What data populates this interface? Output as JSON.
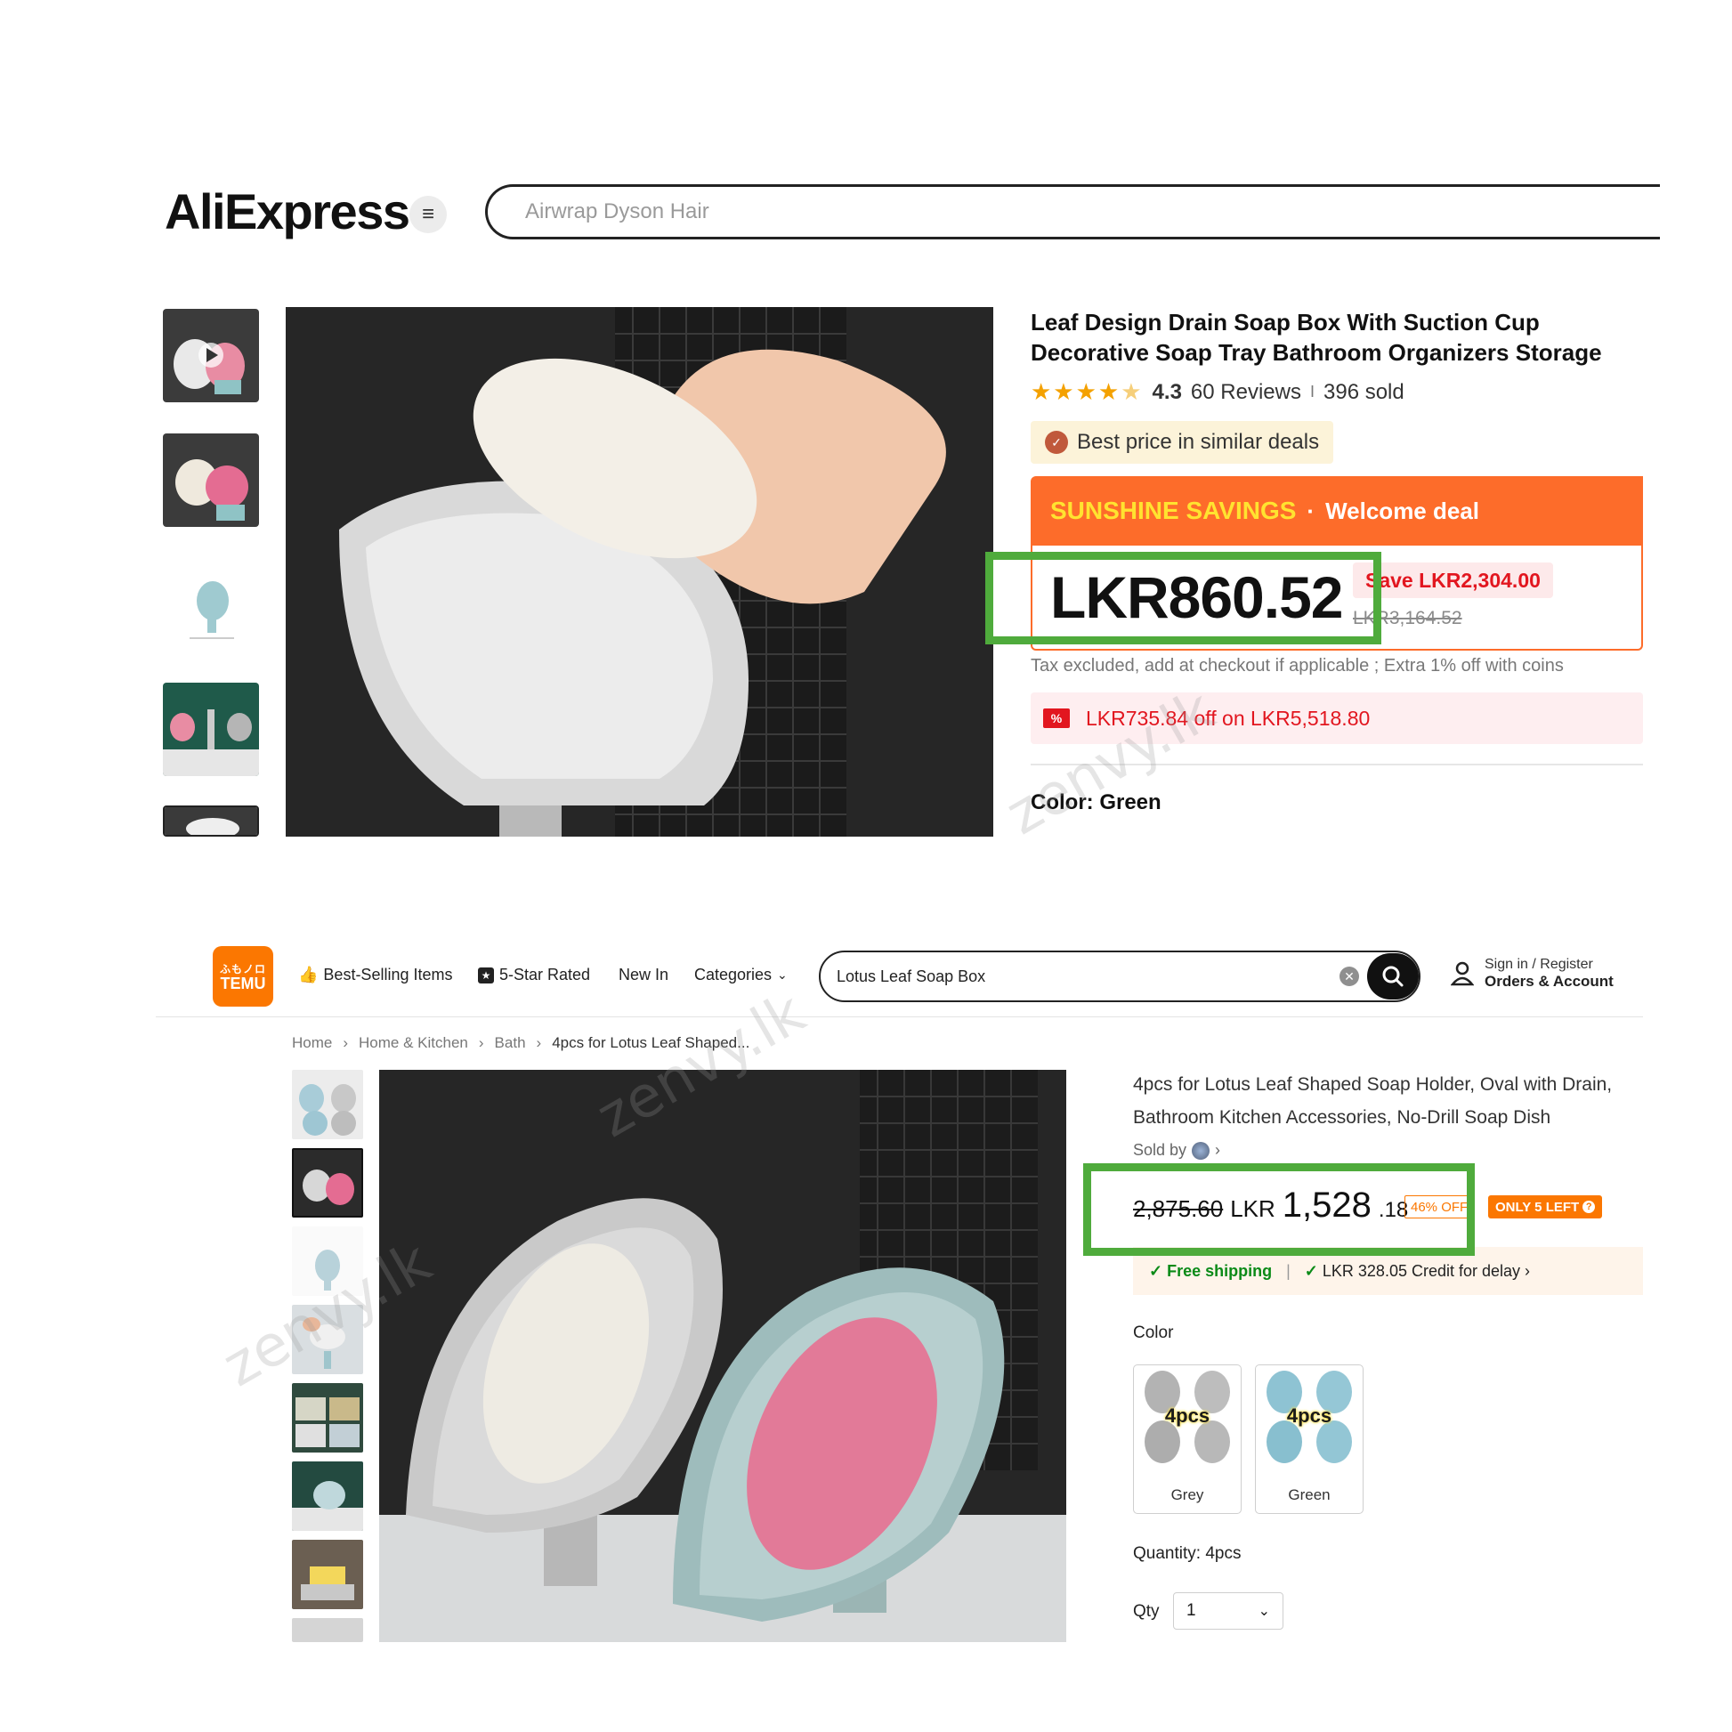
{
  "aliexpress": {
    "logo": "AliExpress",
    "search": {
      "placeholder": "Airwrap Dyson Hair"
    },
    "thumbnails": [
      "product thumbnail 1 (video)",
      "product thumbnail 2",
      "product thumbnail 3",
      "product thumbnail 4",
      "product thumbnail 5"
    ],
    "title": "Leaf Design Drain Soap Box With Suction Cup Decorative Soap Tray Bathroom Organizers Storage",
    "rating": {
      "value": "4.3",
      "stars": 4.3,
      "reviews": "60 Reviews",
      "separator": "I",
      "sold": "396 sold"
    },
    "best_price": "Best price in similar deals",
    "banner": {
      "event": "SUNSHINE SAVINGS",
      "dot": "·",
      "deal": "Welcome deal"
    },
    "price": "LKR860.52",
    "save": "Save LKR2,304.00",
    "original_price": "LKR3,164.52",
    "tax_note": "Tax excluded, add at checkout if applicable ; Extra 1% off with coins",
    "coupon": {
      "icon": "%",
      "text": "LKR735.84 off on LKR5,518.80"
    },
    "color": "Color: Green"
  },
  "temu": {
    "logo": {
      "line1": "ふもノロ",
      "line2": "TEMU"
    },
    "nav": [
      {
        "label": "Best-Selling Items",
        "icon": "thumbs-up-icon"
      },
      {
        "label": "5-Star Rated",
        "icon": "star-badge-icon"
      },
      {
        "label": "New In"
      },
      {
        "label": "Categories",
        "icon": "chevron-down-icon"
      }
    ],
    "search": {
      "value": "Lotus Leaf Soap Box"
    },
    "account": {
      "sign_in": "Sign in / Register",
      "orders": "Orders & Account"
    },
    "breadcrumb": [
      "Home",
      "Home & Kitchen",
      "Bath",
      "4pcs for Lotus Leaf Shaped..."
    ],
    "title": "4pcs for Lotus Leaf Shaped Soap Holder, Oval with Drain, Bathroom Kitchen Accessories, No-Drill Soap Dish",
    "sold_by": "Sold by",
    "price": {
      "original": "2,875.60",
      "currency": "LKR",
      "integer": "1,528",
      "decimal": ".18"
    },
    "discount": "46% OFF",
    "stock": "ONLY 5 LEFT",
    "shipping": {
      "free": "Free shipping",
      "separator": "|",
      "credit": "LKR 328.05 Credit for delay"
    },
    "color_label": "Color",
    "colors": [
      {
        "badge": "4pcs",
        "name": "Grey"
      },
      {
        "badge": "4pcs",
        "name": "Green"
      }
    ],
    "quantity_label": "Quantity: 4pcs",
    "qty": {
      "label": "Qty",
      "value": "1"
    }
  },
  "colors": {
    "ali_orange": "#fd6c2a",
    "ali_red": "#e2161f",
    "temu_orange": "#fb7701",
    "highlight_green": "#4fab3c"
  }
}
